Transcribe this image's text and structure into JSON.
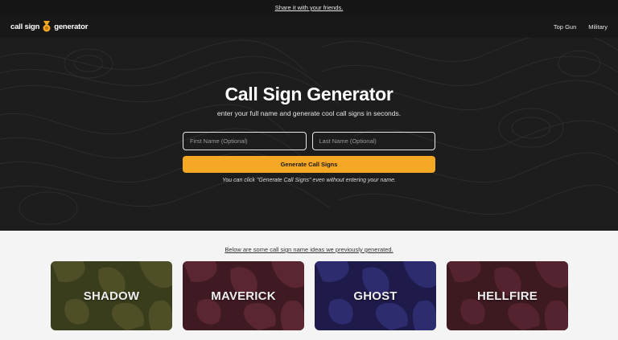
{
  "announcement": {
    "share_link": "Share it with your friends."
  },
  "nav": {
    "logo_left": "call sign",
    "logo_right": "generator",
    "links": [
      "Top Gun",
      "Military"
    ]
  },
  "hero": {
    "title": "Call Sign Generator",
    "subtitle": "enter your full name and generate cool call signs in seconds.",
    "first_name_placeholder": "First Name (Optional)",
    "last_name_placeholder": "Last Name (Optional)",
    "generate_label": "Generate Call Signs",
    "hint": "You can click \"Generate Call Signs\" even without entering your name."
  },
  "examples": {
    "heading": "Below are some call sign name ideas we previously generated.",
    "cards": [
      {
        "name": "SHADOW",
        "base": "#3a3d1c",
        "blob": "#4f4f27"
      },
      {
        "name": "MAVERICK",
        "base": "#3f1a22",
        "blob": "#5a2632"
      },
      {
        "name": "GHOST",
        "base": "#1e1a4a",
        "blob": "#2c2c6e"
      },
      {
        "name": "HELLFIRE",
        "base": "#3d1a20",
        "blob": "#552330"
      }
    ]
  },
  "colors": {
    "accent": "#f4a824",
    "hero_bg": "#1d1d1d"
  }
}
